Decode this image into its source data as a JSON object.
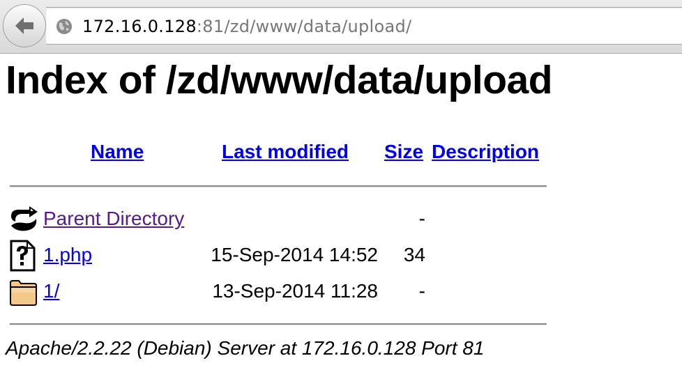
{
  "browser": {
    "url_host": "172.16.0.128",
    "url_rest": ":81/zd/www/data/upload/",
    "icons": {
      "back": "back-arrow-icon",
      "site": "globe-icon"
    }
  },
  "page": {
    "title": "Index of /zd/www/data/upload",
    "columns": {
      "name": "Name",
      "last_modified": "Last modified",
      "size": "Size",
      "description": "Description"
    },
    "rows": [
      {
        "icon": "parent-directory-icon",
        "name": "Parent Directory",
        "modified": "",
        "size": "-",
        "description": ""
      },
      {
        "icon": "unknown-file-icon",
        "name": "1.php",
        "modified": "15-Sep-2014 14:52",
        "size": "34",
        "description": ""
      },
      {
        "icon": "folder-icon",
        "name": "1/",
        "modified": "13-Sep-2014 11:28",
        "size": "-",
        "description": ""
      }
    ],
    "footer": "Apache/2.2.22 (Debian) Server at 172.16.0.128 Port 81"
  },
  "colors": {
    "link": "#0000ee",
    "visited_link": "#551a8b",
    "url_path": "#777777"
  }
}
